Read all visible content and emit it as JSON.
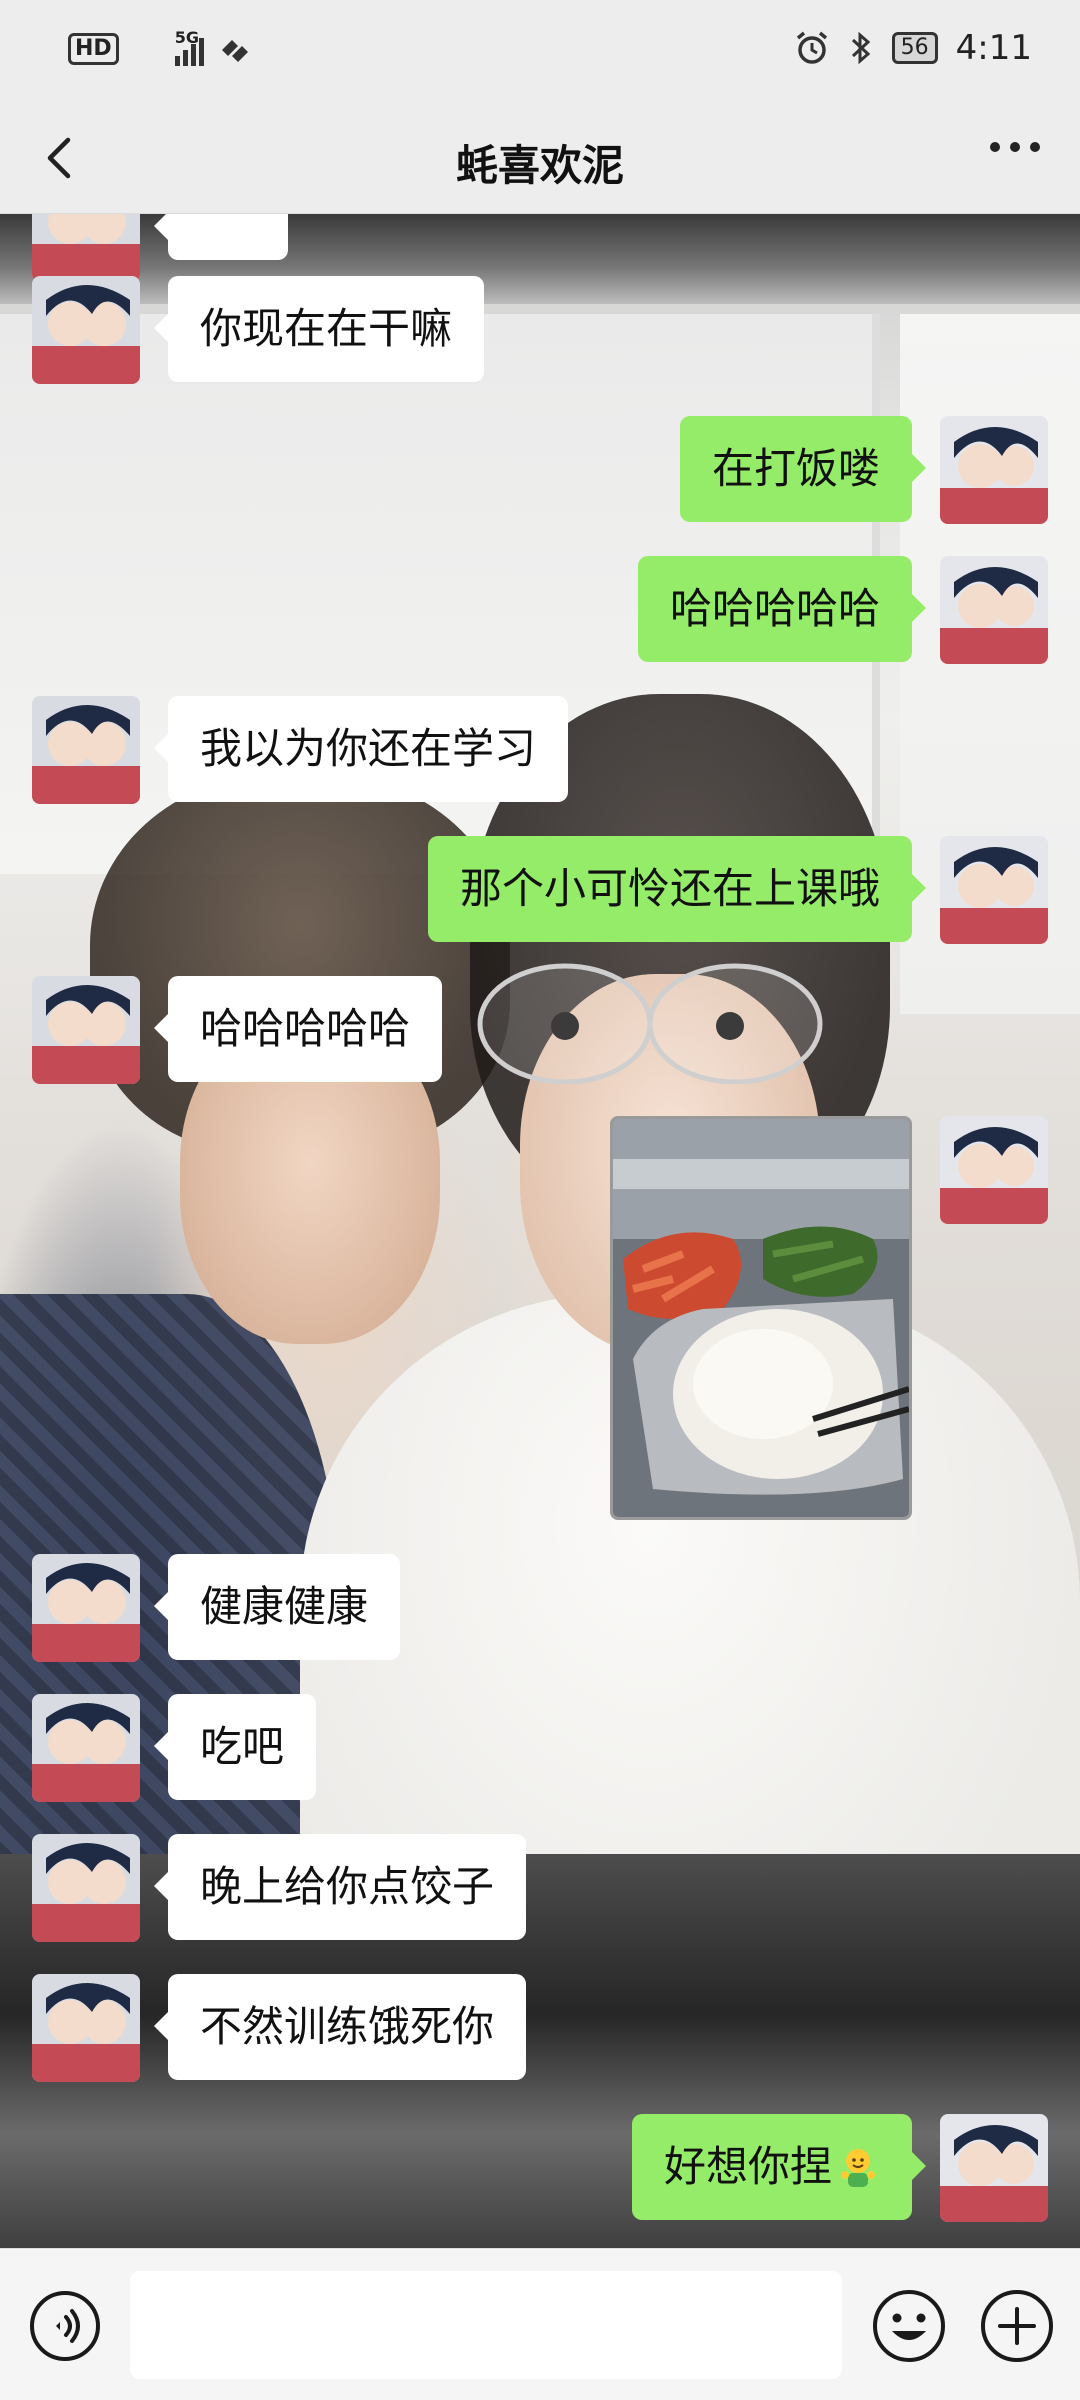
{
  "status_bar": {
    "hd_label": "HD",
    "network_label": "5G",
    "battery": "56",
    "time": "4:11"
  },
  "header": {
    "title": "蚝喜欢泥",
    "back_icon": "chevron-left-icon",
    "more_icon": "more-dots-icon"
  },
  "messages": [
    {
      "side": "left",
      "type": "text",
      "text": "你现在在干嘛"
    },
    {
      "side": "right",
      "type": "text",
      "text": "在打饭喽"
    },
    {
      "side": "right",
      "type": "text",
      "text": "哈哈哈哈哈"
    },
    {
      "side": "left",
      "type": "text",
      "text": "我以为你还在学习"
    },
    {
      "side": "right",
      "type": "text",
      "text": "那个小可怜还在上课哦"
    },
    {
      "side": "left",
      "type": "text",
      "text": "哈哈哈哈哈"
    },
    {
      "side": "right",
      "type": "image",
      "alt_icon": "food-tray-photo"
    },
    {
      "side": "left",
      "type": "text",
      "text": "健康健康"
    },
    {
      "side": "left",
      "type": "text",
      "text": "吃吧"
    },
    {
      "side": "left",
      "type": "text",
      "text": "晚上给你点饺子"
    },
    {
      "side": "left",
      "type": "text",
      "text": "不然训练饿死你"
    },
    {
      "side": "right",
      "type": "text",
      "text": "好想你捏",
      "emoji": "hug-emoji-icon"
    }
  ],
  "input_bar": {
    "voice_icon": "voice-icon",
    "emoji_icon": "smile-icon",
    "plus_icon": "plus-icon",
    "text_value": ""
  },
  "colors": {
    "bubble_self": "#95ec69",
    "bubble_other": "#ffffff",
    "header_bg": "#ededed"
  }
}
